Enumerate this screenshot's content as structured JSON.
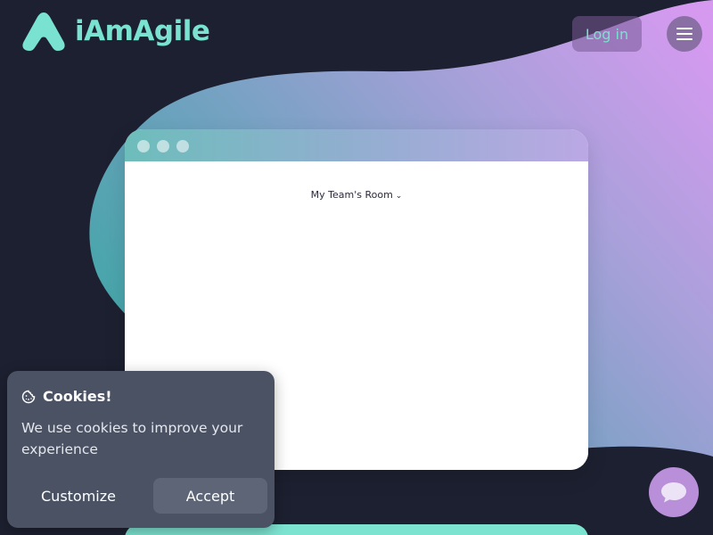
{
  "header": {
    "brand": "iAmAgile",
    "login_label": "Log in"
  },
  "icons": {
    "logo": "agile-logo-icon",
    "menu": "hamburger-menu-icon",
    "cookie": "cookie-icon",
    "chat": "chat-bubble-icon"
  },
  "preview": {
    "room_selector": "My Team's Room"
  },
  "cookie_banner": {
    "title": "Cookies!",
    "message": "We use cookies to improve your experience",
    "customize_label": "Customize",
    "accept_label": "Accept"
  },
  "colors": {
    "page_bg": "#1d2030",
    "brand_teal": "#79e2d0",
    "gradient_start": "#4aa4a8",
    "gradient_end": "#cf95ea",
    "cookie_bg": "#4a5264",
    "chat_bg": "#b98fd9"
  }
}
